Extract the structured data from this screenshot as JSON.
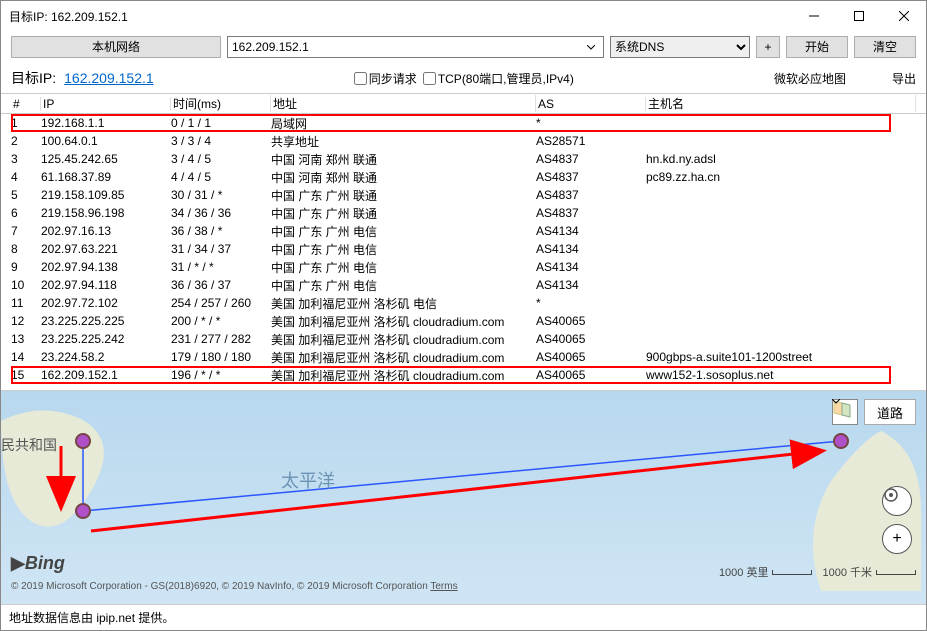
{
  "window": {
    "title": "目标IP: 162.209.152.1"
  },
  "toolbar": {
    "network_btn": "本机网络",
    "ip_value": "162.209.152.1",
    "dns_selected": "系统DNS",
    "plus": "+",
    "start": "开始",
    "clear": "清空"
  },
  "subbar": {
    "target_label": "目标IP:",
    "target_ip": "162.209.152.1",
    "chk_sync": "同步请求",
    "chk_tcp": "TCP(80端口,管理员,IPv4)",
    "bing_map": "微软必应地图",
    "export": "导出"
  },
  "columns": {
    "num": "#",
    "ip": "IP",
    "time": "时间(ms)",
    "addr": "地址",
    "as": "AS",
    "host": "主机名"
  },
  "rows": [
    {
      "n": "1",
      "ip": "192.168.1.1",
      "time": "0 / 1 / 1",
      "addr": "局域网",
      "as": "*",
      "host": ""
    },
    {
      "n": "2",
      "ip": "100.64.0.1",
      "time": "3 / 3 / 4",
      "addr": "共享地址",
      "as": "AS28571",
      "host": ""
    },
    {
      "n": "3",
      "ip": "125.45.242.65",
      "time": "3 / 4 / 5",
      "addr": "中国 河南 郑州 联通",
      "as": "AS4837",
      "host": "hn.kd.ny.adsl"
    },
    {
      "n": "4",
      "ip": "61.168.37.89",
      "time": "4 / 4 / 5",
      "addr": "中国 河南 郑州 联通",
      "as": "AS4837",
      "host": "pc89.zz.ha.cn"
    },
    {
      "n": "5",
      "ip": "219.158.109.85",
      "time": "30 / 31 / *",
      "addr": "中国 广东 广州 联通",
      "as": "AS4837",
      "host": ""
    },
    {
      "n": "6",
      "ip": "219.158.96.198",
      "time": "34 / 36 / 36",
      "addr": "中国 广东 广州 联通",
      "as": "AS4837",
      "host": ""
    },
    {
      "n": "7",
      "ip": "202.97.16.13",
      "time": "36 / 38 / *",
      "addr": "中国 广东 广州 电信",
      "as": "AS4134",
      "host": ""
    },
    {
      "n": "8",
      "ip": "202.97.63.221",
      "time": "31 / 34 / 37",
      "addr": "中国 广东 广州 电信",
      "as": "AS4134",
      "host": ""
    },
    {
      "n": "9",
      "ip": "202.97.94.138",
      "time": "31 / * / *",
      "addr": "中国 广东 广州 电信",
      "as": "AS4134",
      "host": ""
    },
    {
      "n": "10",
      "ip": "202.97.94.118",
      "time": "36 / 36 / 37",
      "addr": "中国 广东 广州 电信",
      "as": "AS4134",
      "host": ""
    },
    {
      "n": "11",
      "ip": "202.97.72.102",
      "time": "254 / 257 / 260",
      "addr": "美国 加利福尼亚州 洛杉矶 电信",
      "as": "*",
      "host": ""
    },
    {
      "n": "12",
      "ip": "23.225.225.225",
      "time": "200 / * / *",
      "addr": "美国 加利福尼亚州 洛杉矶 cloudradium.com",
      "as": "AS40065",
      "host": ""
    },
    {
      "n": "13",
      "ip": "23.225.225.242",
      "time": "231 / 277 / 282",
      "addr": "美国 加利福尼亚州 洛杉矶 cloudradium.com",
      "as": "AS40065",
      "host": ""
    },
    {
      "n": "14",
      "ip": "23.224.58.2",
      "time": "179 / 180 / 180",
      "addr": "美国 加利福尼亚州 洛杉矶 cloudradium.com",
      "as": "AS40065",
      "host": "900gbps-a.suite101-1200street"
    },
    {
      "n": "15",
      "ip": "162.209.152.1",
      "time": "196 / * / *",
      "addr": "美国 加利福尼亚州 洛杉矶 cloudradium.com",
      "as": "AS40065",
      "host": "www152-1.sosoplus.net"
    }
  ],
  "map": {
    "pacific": "太平洋",
    "china": "民共和国",
    "road_btn": "道路",
    "scale_mi": "1000 英里",
    "scale_km": "1000 千米",
    "bing": "Bing",
    "copyright": "© 2019 Microsoft Corporation - GS(2018)6920, © 2019 NavInfo, © 2019 Microsoft Corporation ",
    "terms": "Terms"
  },
  "footer": {
    "text": "地址数据信息由 ipip.net 提供。"
  }
}
